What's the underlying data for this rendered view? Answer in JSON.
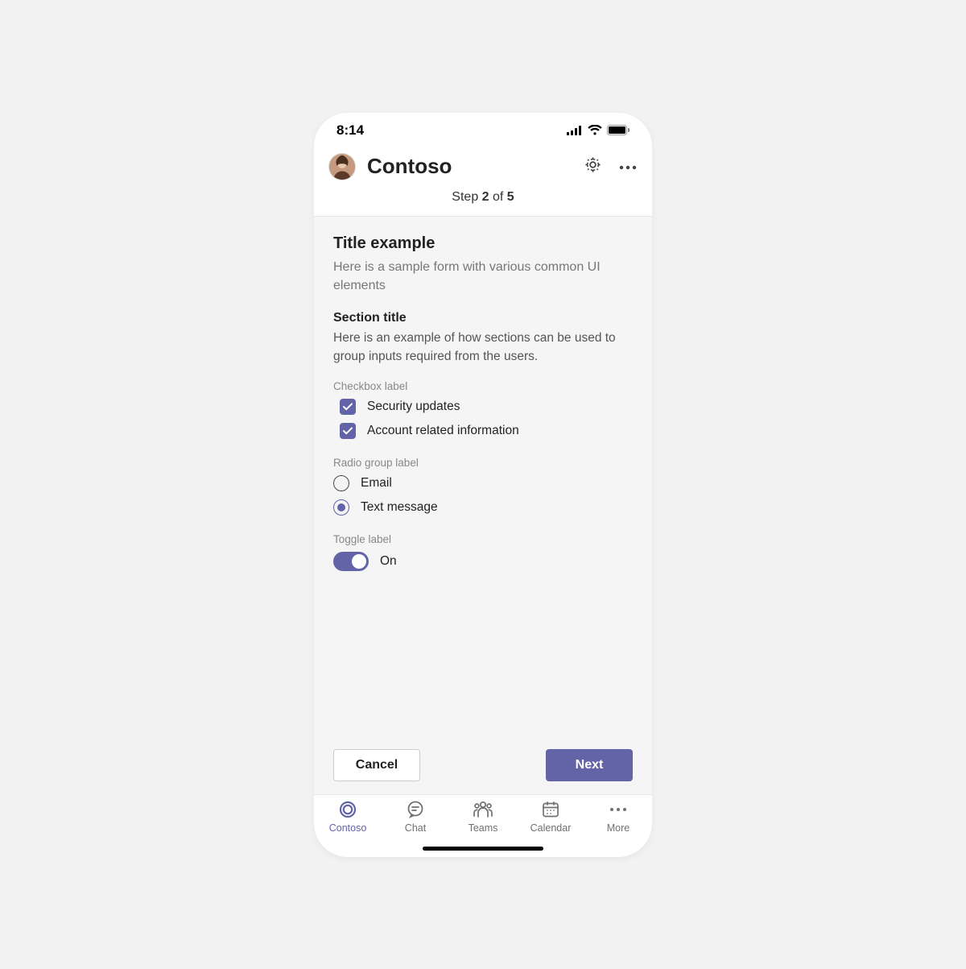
{
  "status": {
    "time": "8:14"
  },
  "header": {
    "title": "Contoso"
  },
  "step": {
    "prefix": "Step ",
    "current": "2",
    "mid": " of ",
    "total": "5"
  },
  "form": {
    "title": "Title example",
    "subtitle": "Here is a sample form with various common UI elements",
    "section_title": "Section title",
    "section_desc": "Here is an example of how sections can be used to group inputs required from the users.",
    "checkbox_label": "Checkbox label",
    "checkboxes": [
      {
        "label": "Security updates",
        "checked": true
      },
      {
        "label": "Account related information",
        "checked": true
      }
    ],
    "radio_label": "Radio group label",
    "radios": [
      {
        "label": "Email",
        "selected": false
      },
      {
        "label": "Text message",
        "selected": true
      }
    ],
    "toggle_label": "Toggle label",
    "toggle_state": "On"
  },
  "buttons": {
    "cancel": "Cancel",
    "next": "Next"
  },
  "tabs": [
    {
      "label": "Contoso",
      "active": true
    },
    {
      "label": "Chat",
      "active": false
    },
    {
      "label": "Teams",
      "active": false
    },
    {
      "label": "Calendar",
      "active": false
    },
    {
      "label": "More",
      "active": false
    }
  ],
  "colors": {
    "accent": "#6264a7"
  }
}
